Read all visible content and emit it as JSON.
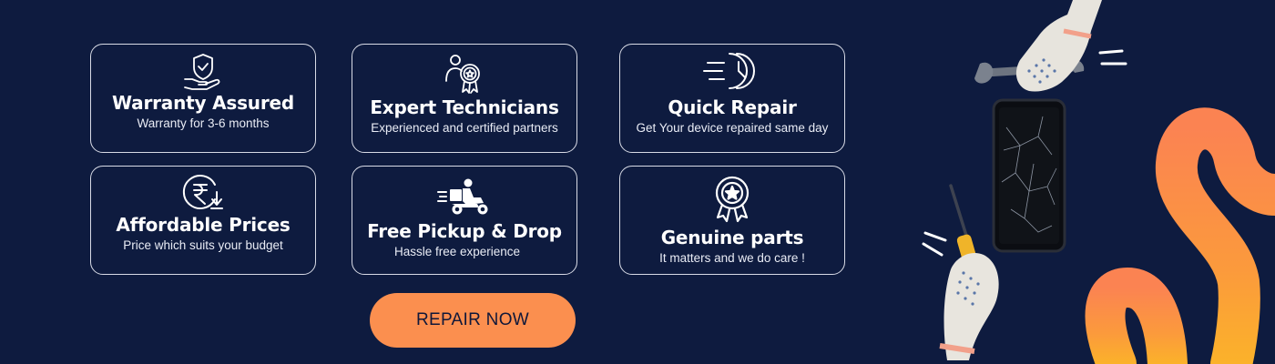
{
  "features": [
    {
      "title": "Warranty Assured",
      "subtitle": "Warranty for 3-6 months",
      "icon": "shield-hand-icon"
    },
    {
      "title": "Expert Technicians",
      "subtitle": "Experienced and certified partners",
      "icon": "technician-badge-icon"
    },
    {
      "title": "Quick Repair",
      "subtitle": "Get Your device repaired same day",
      "icon": "fast-clock-icon"
    },
    {
      "title": "Affordable Prices",
      "subtitle": "Price which suits your budget",
      "icon": "rupee-down-icon"
    },
    {
      "title": "Free Pickup & Drop",
      "subtitle": "Hassle free experience",
      "icon": "delivery-scooter-icon"
    },
    {
      "title": "Genuine parts",
      "subtitle": "It matters and we do care !",
      "icon": "award-ribbon-icon"
    }
  ],
  "cta": {
    "label": "REPAIR NOW"
  },
  "colors": {
    "background": "#0e1b3f",
    "accent": "#fb8f4f",
    "card_border": "#d8dbe6"
  }
}
